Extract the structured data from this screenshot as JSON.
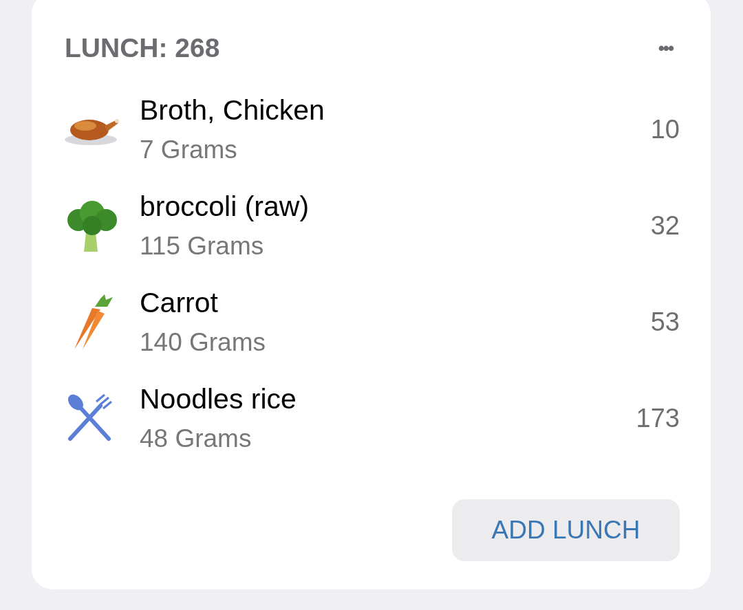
{
  "meal": {
    "title": "LUNCH: 268",
    "menu": "•••"
  },
  "items": [
    {
      "name": "Broth, Chicken",
      "amount": "7 Grams",
      "calories": "10"
    },
    {
      "name": "broccoli (raw)",
      "amount": "115 Grams",
      "calories": "32"
    },
    {
      "name": "Carrot",
      "amount": "140 Grams",
      "calories": "53"
    },
    {
      "name": "Noodles rice",
      "amount": "48 Grams",
      "calories": "173"
    }
  ],
  "add_button": "ADD LUNCH"
}
